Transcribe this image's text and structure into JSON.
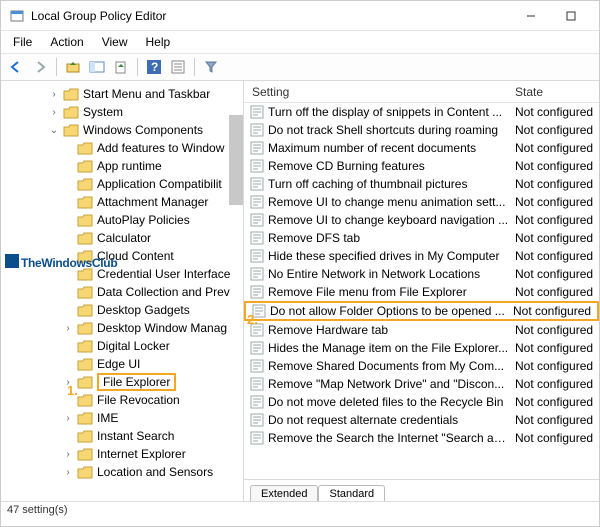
{
  "window": {
    "title": "Local Group Policy Editor"
  },
  "menu": {
    "file": "File",
    "action": "Action",
    "view": "View",
    "help": "Help"
  },
  "columns": {
    "setting": "Setting",
    "state": "State"
  },
  "tree": {
    "items": [
      {
        "label": "Start Menu and Taskbar",
        "indent": 2,
        "twisty": ">"
      },
      {
        "label": "System",
        "indent": 2,
        "twisty": ">"
      },
      {
        "label": "Windows Components",
        "indent": 2,
        "twisty": "v"
      },
      {
        "label": "Add features to Window",
        "indent": 3,
        "twisty": ""
      },
      {
        "label": "App runtime",
        "indent": 3,
        "twisty": ""
      },
      {
        "label": "Application Compatibilit",
        "indent": 3,
        "twisty": ""
      },
      {
        "label": "Attachment Manager",
        "indent": 3,
        "twisty": ""
      },
      {
        "label": "AutoPlay Policies",
        "indent": 3,
        "twisty": ""
      },
      {
        "label": "Calculator",
        "indent": 3,
        "twisty": ""
      },
      {
        "label": "Cloud Content",
        "indent": 3,
        "twisty": ""
      },
      {
        "label": "Credential User Interface",
        "indent": 3,
        "twisty": ""
      },
      {
        "label": "Data Collection and Prev",
        "indent": 3,
        "twisty": ""
      },
      {
        "label": "Desktop Gadgets",
        "indent": 3,
        "twisty": ""
      },
      {
        "label": "Desktop Window Manag",
        "indent": 3,
        "twisty": ">"
      },
      {
        "label": "Digital Locker",
        "indent": 3,
        "twisty": ""
      },
      {
        "label": "Edge UI",
        "indent": 3,
        "twisty": ""
      },
      {
        "label": "File Explorer",
        "indent": 3,
        "twisty": ">",
        "selected": true
      },
      {
        "label": "File Revocation",
        "indent": 3,
        "twisty": ""
      },
      {
        "label": "IME",
        "indent": 3,
        "twisty": ">"
      },
      {
        "label": "Instant Search",
        "indent": 3,
        "twisty": ""
      },
      {
        "label": "Internet Explorer",
        "indent": 3,
        "twisty": ">"
      },
      {
        "label": "Location and Sensors",
        "indent": 3,
        "twisty": ">"
      }
    ]
  },
  "settings": {
    "rows": [
      {
        "label": "Turn off the display of snippets in Content ...",
        "state": "Not configured"
      },
      {
        "label": "Do not track Shell shortcuts during roaming",
        "state": "Not configured"
      },
      {
        "label": "Maximum number of recent documents",
        "state": "Not configured"
      },
      {
        "label": "Remove CD Burning features",
        "state": "Not configured"
      },
      {
        "label": "Turn off caching of thumbnail pictures",
        "state": "Not configured"
      },
      {
        "label": "Remove UI to change menu animation sett...",
        "state": "Not configured"
      },
      {
        "label": "Remove UI to change keyboard navigation ...",
        "state": "Not configured"
      },
      {
        "label": "Remove DFS tab",
        "state": "Not configured"
      },
      {
        "label": "Hide these specified drives in My Computer",
        "state": "Not configured"
      },
      {
        "label": "No Entire Network in Network Locations",
        "state": "Not configured"
      },
      {
        "label": "Remove File menu from File Explorer",
        "state": "Not configured"
      },
      {
        "label": "Do not allow Folder Options to be opened ...",
        "state": "Not configured",
        "hl": true
      },
      {
        "label": "Remove Hardware tab",
        "state": "Not configured"
      },
      {
        "label": "Hides the Manage item on the File Explorer...",
        "state": "Not configured"
      },
      {
        "label": "Remove Shared Documents from My Com...",
        "state": "Not configured"
      },
      {
        "label": "Remove \"Map Network Drive\" and \"Discon...",
        "state": "Not configured"
      },
      {
        "label": "Do not move deleted files to the Recycle Bin",
        "state": "Not configured"
      },
      {
        "label": "Do not request alternate credentials",
        "state": "Not configured"
      },
      {
        "label": "Remove the Search the Internet \"Search ag...",
        "state": "Not configured"
      }
    ]
  },
  "tabs": {
    "extended": "Extended",
    "standard": "Standard"
  },
  "status": {
    "text": "47 setting(s)"
  },
  "callouts": {
    "one": "1.",
    "two": "2."
  },
  "watermark": {
    "text": "TheWindowsClub"
  }
}
